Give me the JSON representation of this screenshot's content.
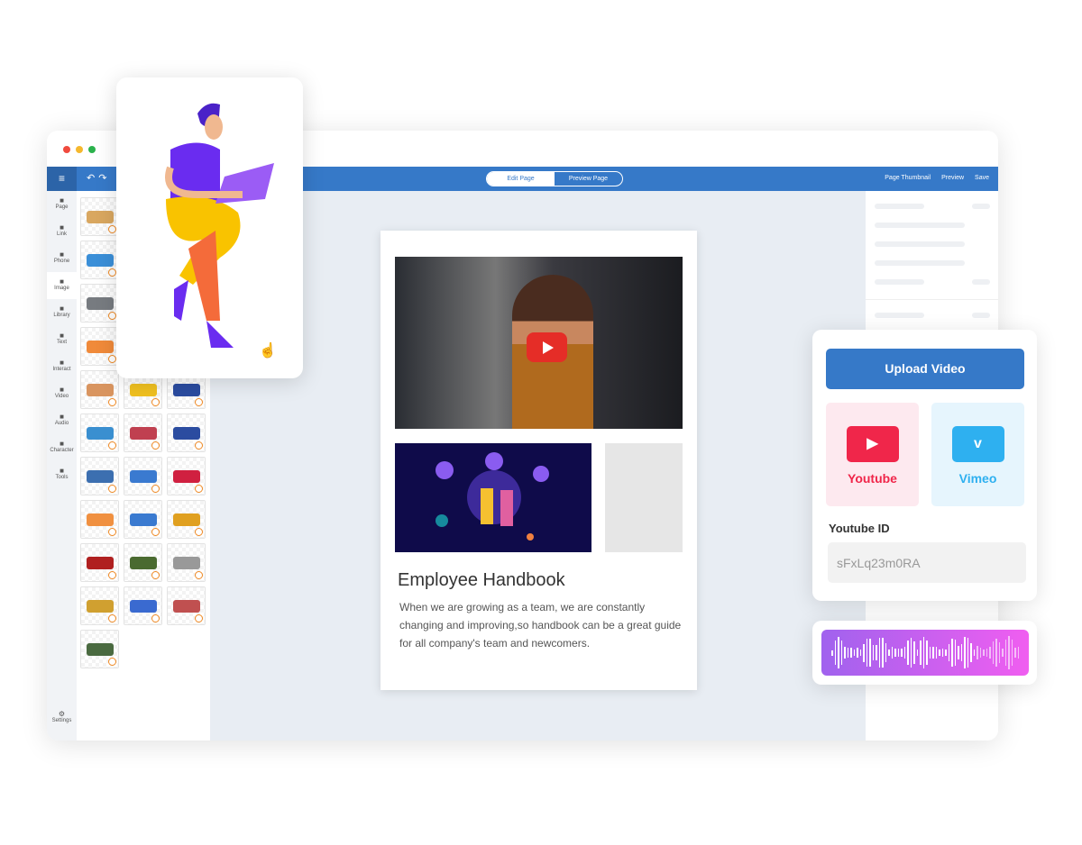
{
  "window": {
    "dots": [
      "#f04a3e",
      "#f5b82e",
      "#2bb24c"
    ]
  },
  "toolbar": {
    "menu_icon": "hamburger-icon",
    "edit_page": "Edit Page",
    "preview_page": "Preview Page",
    "page_thumbnail": "Page Thumbnail",
    "preview": "Preview",
    "save": "Save",
    "color": "#3679c8"
  },
  "rail": [
    {
      "label": "Page",
      "icon": "page-icon"
    },
    {
      "label": "Link",
      "icon": "link-icon"
    },
    {
      "label": "Phone",
      "icon": "phone-icon"
    },
    {
      "label": "Image",
      "icon": "image-icon",
      "selected": true
    },
    {
      "label": "Library",
      "icon": "library-icon"
    },
    {
      "label": "Text",
      "icon": "text-icon"
    },
    {
      "label": "Interact",
      "icon": "interact-icon"
    },
    {
      "label": "Video",
      "icon": "video-icon"
    },
    {
      "label": "Audio",
      "icon": "audio-icon"
    },
    {
      "label": "Character",
      "icon": "character-icon"
    },
    {
      "label": "Tools",
      "icon": "tools-icon"
    }
  ],
  "rail_settings": "Settings",
  "assets": [
    "#d9a760",
    "#ecdcc0",
    "#e8333a",
    "#3b8fd8",
    "#d8d39a",
    "#9b1c2c",
    "#777b80",
    "#333",
    "#e04040",
    "#f08a3a",
    "#4a90e2",
    "#b02050",
    "#d99560",
    "#f0c020",
    "#2b4ca0",
    "#3a8fd0",
    "#c04050",
    "#2b4ca0",
    "#3c6fb0",
    "#3a7ad0",
    "#d02040",
    "#f09040",
    "#3a7ad0",
    "#e0a020",
    "#b02020",
    "#4a6a30",
    "#999",
    "#d0a030",
    "#3a6ad0",
    "#c05050",
    "#4a6a40"
  ],
  "page": {
    "title": "Employee Handbook",
    "description": "When we are growing as a team, we are constantly changing and improving,so handbook can be a great guide for all company's team and newcomers."
  },
  "upload": {
    "button": "Upload Video",
    "sources": [
      {
        "label": "Youtube",
        "color": "#f0264a",
        "bg": "#fde9ef"
      },
      {
        "label": "Vimeo",
        "color": "#2eb0f0",
        "bg": "#e6f5fd"
      }
    ],
    "id_label": "Youtube ID",
    "id_value": "sFxLq23m0RA"
  }
}
